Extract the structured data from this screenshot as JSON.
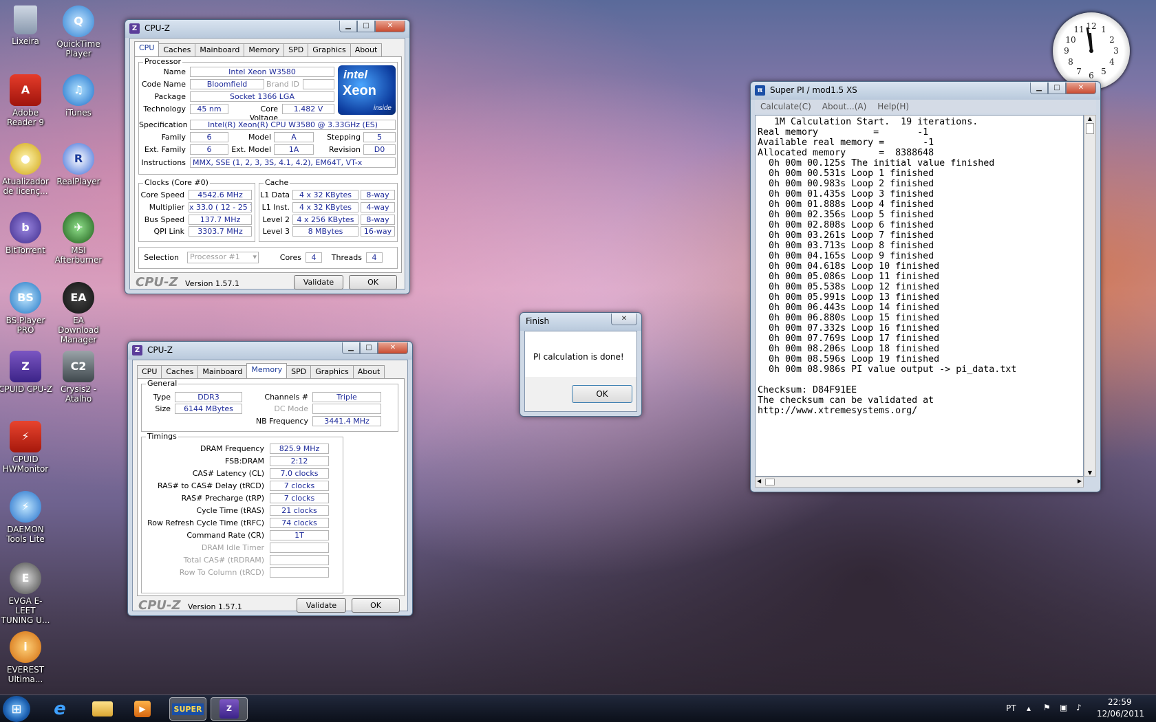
{
  "desktop": {
    "icons": [
      {
        "label": "Lixeira"
      },
      {
        "label": "QuickTime Player"
      },
      {
        "label": "Adobe Reader 9"
      },
      {
        "label": "iTunes"
      },
      {
        "label": "Atualizador de licenç..."
      },
      {
        "label": "RealPlayer"
      },
      {
        "label": "BitTorrent"
      },
      {
        "label": "MSI Afterburner"
      },
      {
        "label": "BS.Player PRO"
      },
      {
        "label": "EA Download Manager"
      },
      {
        "label": "CPUID CPU-Z"
      },
      {
        "label": "Crysis2 - Atalho"
      },
      {
        "label": "CPUID HWMonitor"
      },
      {
        "label": "DAEMON Tools Lite"
      },
      {
        "label": "EVGA E-LEET TUNING U..."
      },
      {
        "label": "EVEREST Ultima..."
      }
    ]
  },
  "cpuz1": {
    "title": "CPU-Z",
    "tabs": [
      "CPU",
      "Caches",
      "Mainboard",
      "Memory",
      "SPD",
      "Graphics",
      "About"
    ],
    "processor": {
      "group": "Processor",
      "name_label": "Name",
      "name": "Intel Xeon W3580",
      "codename_label": "Code Name",
      "codename": "Bloomfield",
      "brandid_label": "Brand ID",
      "package_label": "Package",
      "package": "Socket 1366 LGA",
      "tech_label": "Technology",
      "tech": "45 nm",
      "voltage_label": "Core Voltage",
      "voltage": "1.482 V",
      "spec_label": "Specification",
      "spec": "Intel(R) Xeon(R) CPU         W3580  @ 3.33GHz (ES)",
      "family_label": "Family",
      "family": "6",
      "model_label": "Model",
      "model": "A",
      "stepping_label": "Stepping",
      "stepping": "5",
      "extfamily_label": "Ext. Family",
      "extfamily": "6",
      "extmodel_label": "Ext. Model",
      "extmodel": "1A",
      "revision_label": "Revision",
      "revision": "D0",
      "instr_label": "Instructions",
      "instr": "MMX, SSE (1, 2, 3, 3S, 4.1, 4.2), EM64T, VT-x",
      "logo_brand": "intel",
      "logo_product": "Xeon",
      "logo_inside": "inside"
    },
    "clocks": {
      "group": "Clocks (Core #0)",
      "corespeed_label": "Core Speed",
      "corespeed": "4542.6 MHz",
      "mult_label": "Multiplier",
      "mult": "x 33.0 ( 12 - 25 )",
      "bus_label": "Bus Speed",
      "bus": "137.7 MHz",
      "qpi_label": "QPI Link",
      "qpi": "3303.7 MHz"
    },
    "cache": {
      "group": "Cache",
      "l1d_label": "L1 Data",
      "l1d": "4 x 32 KBytes",
      "l1d_way": "8-way",
      "l1i_label": "L1 Inst.",
      "l1i": "4 x 32 KBytes",
      "l1i_way": "4-way",
      "l2_label": "Level 2",
      "l2": "4 x 256 KBytes",
      "l2_way": "8-way",
      "l3_label": "Level 3",
      "l3": "8 MBytes",
      "l3_way": "16-way"
    },
    "selection_label": "Selection",
    "selection": "Processor #1",
    "cores_label": "Cores",
    "cores": "4",
    "threads_label": "Threads",
    "threads": "4",
    "brand": "CPU-Z",
    "version": "Version 1.57.1",
    "validate": "Validate",
    "ok": "OK"
  },
  "cpuz2": {
    "title": "CPU-Z",
    "tabs": [
      "CPU",
      "Caches",
      "Mainboard",
      "Memory",
      "SPD",
      "Graphics",
      "About"
    ],
    "general": {
      "group": "General",
      "type_label": "Type",
      "type": "DDR3",
      "size_label": "Size",
      "size": "6144 MBytes",
      "channels_label": "Channels #",
      "channels": "Triple",
      "dcmode_label": "DC Mode",
      "nbfreq_label": "NB Frequency",
      "nbfreq": "3441.4 MHz"
    },
    "timings": {
      "group": "Timings",
      "rows": [
        {
          "label": "DRAM Frequency",
          "value": "825.9 MHz"
        },
        {
          "label": "FSB:DRAM",
          "value": "2:12"
        },
        {
          "label": "CAS# Latency (CL)",
          "value": "7.0 clocks"
        },
        {
          "label": "RAS# to CAS# Delay (tRCD)",
          "value": "7 clocks"
        },
        {
          "label": "RAS# Precharge (tRP)",
          "value": "7 clocks"
        },
        {
          "label": "Cycle Time (tRAS)",
          "value": "21 clocks"
        },
        {
          "label": "Row Refresh Cycle Time (tRFC)",
          "value": "74 clocks"
        },
        {
          "label": "Command Rate (CR)",
          "value": "1T"
        },
        {
          "label": "DRAM Idle Timer",
          "value": ""
        },
        {
          "label": "Total CAS# (tRDRAM)",
          "value": ""
        },
        {
          "label": "Row To Column (tRCD)",
          "value": ""
        }
      ]
    },
    "brand": "CPU-Z",
    "version": "Version 1.57.1",
    "validate": "Validate",
    "ok": "OK"
  },
  "finish": {
    "title": "Finish",
    "message": "PI calculation is done!",
    "ok": "OK"
  },
  "superpi": {
    "title": "Super PI / mod1.5 XS",
    "menu": [
      "Calculate(C)",
      "About...(A)",
      "Help(H)"
    ],
    "lines": [
      "   1M Calculation Start.  19 iterations.",
      "Real memory          =       -1",
      "Available real memory =       -1",
      "Allocated memory      =  8388648",
      "  0h 00m 00.125s The initial value finished",
      "  0h 00m 00.531s Loop 1 finished",
      "  0h 00m 00.983s Loop 2 finished",
      "  0h 00m 01.435s Loop 3 finished",
      "  0h 00m 01.888s Loop 4 finished",
      "  0h 00m 02.356s Loop 5 finished",
      "  0h 00m 02.808s Loop 6 finished",
      "  0h 00m 03.261s Loop 7 finished",
      "  0h 00m 03.713s Loop 8 finished",
      "  0h 00m 04.165s Loop 9 finished",
      "  0h 00m 04.618s Loop 10 finished",
      "  0h 00m 05.086s Loop 11 finished",
      "  0h 00m 05.538s Loop 12 finished",
      "  0h 00m 05.991s Loop 13 finished",
      "  0h 00m 06.443s Loop 14 finished",
      "  0h 00m 06.880s Loop 15 finished",
      "  0h 00m 07.332s Loop 16 finished",
      "  0h 00m 07.769s Loop 17 finished",
      "  0h 00m 08.206s Loop 18 finished",
      "  0h 00m 08.596s Loop 19 finished",
      "  0h 00m 08.986s PI value output -> pi_data.txt",
      "",
      "Checksum: D84F91EE",
      "The checksum can be validated at",
      "http://www.xtremesystems.org/"
    ]
  },
  "taskbar": {
    "language": "PT",
    "time": "22:59",
    "date": "12/06/2011",
    "superpi_label": "SUPER"
  },
  "colors": {
    "value_text": "#1d2a9a",
    "active_tab": "#1a3a9a",
    "close_button": "#c94a2f"
  }
}
